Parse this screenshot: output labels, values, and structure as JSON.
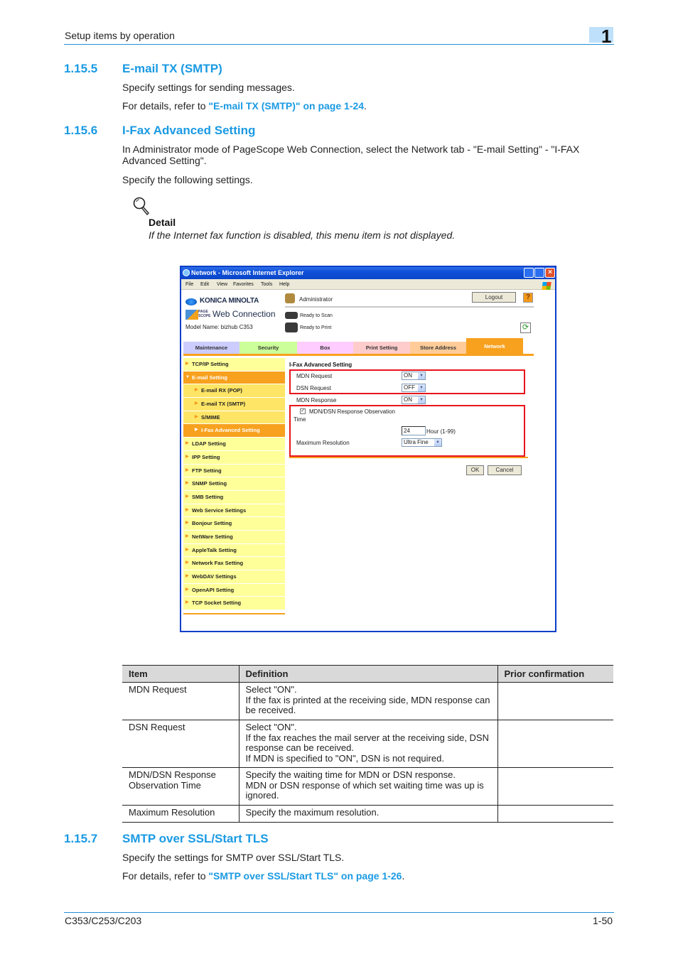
{
  "page_header": {
    "section": "Setup items by operation",
    "chapter": "1"
  },
  "sections": [
    {
      "number": "1.15.5",
      "title": "E-mail TX (SMTP)",
      "paragraphs": [
        "Specify settings for sending messages."
      ],
      "ref_prefix": "For details, refer to ",
      "ref_link": "\"E-mail TX (SMTP)\" on page 1-24",
      "ref_suffix": "."
    },
    {
      "number": "1.15.6",
      "title": "I-Fax Advanced Setting",
      "paragraphs": [
        "In Administrator mode of PageScope Web Connection, select the Network tab - \"E-mail Setting\" - \"I-FAX Advanced Setting\".",
        "Specify the following settings."
      ],
      "detail": {
        "icon": "magnifier-icon",
        "title": "Detail",
        "text": "If the Internet fax function is disabled, this menu item is not displayed."
      }
    },
    {
      "number": "1.15.7",
      "title": "SMTP over SSL/Start TLS",
      "paragraphs": [
        "Specify the settings for SMTP over SSL/Start TLS."
      ],
      "ref_prefix": "For details, refer to ",
      "ref_link": "\"SMTP over SSL/Start TLS\" on page 1-26",
      "ref_suffix": "."
    }
  ],
  "screenshot": {
    "window_title": "Network - Microsoft Internet Explorer",
    "menu": [
      "File",
      "Edit",
      "View",
      "Favorites",
      "Tools",
      "Help"
    ],
    "brand": "KONICA MINOLTA",
    "product_small": "PAGE SCOPE",
    "product": "Web Connection",
    "model": "Model Name: bizhub C353",
    "user": "Administrator",
    "logout": "Logout",
    "help": "?",
    "status_scan": "Ready to Scan",
    "status_print": "Ready to Print",
    "tabs": [
      {
        "label": "Maintenance",
        "color": "#ccccff"
      },
      {
        "label": "Security",
        "color": "#ccff99"
      },
      {
        "label": "Box",
        "color": "#ffccff"
      },
      {
        "label": "Print Setting",
        "color": "#ffcccc"
      },
      {
        "label": "Store Address",
        "color": "#ffcc99"
      },
      {
        "label": "Network",
        "color": "#f7a11e",
        "active": true
      }
    ],
    "sidebar": [
      {
        "label": "TCP/IP Setting"
      },
      {
        "label": "E-mail Setting",
        "active": true,
        "expanded": true
      },
      {
        "label": "E-mail RX (POP)",
        "sub": true
      },
      {
        "label": "E-mail TX (SMTP)",
        "sub": true
      },
      {
        "label": "S/MIME",
        "sub": true
      },
      {
        "label": "I-Fax Advanced Setting",
        "sub": true,
        "active": true
      },
      {
        "label": "LDAP Setting"
      },
      {
        "label": "IPP Setting"
      },
      {
        "label": "FTP Setting"
      },
      {
        "label": "SNMP Setting"
      },
      {
        "label": "SMB Setting"
      },
      {
        "label": "Web Service Settings"
      },
      {
        "label": "Bonjour Setting"
      },
      {
        "label": "NetWare Setting"
      },
      {
        "label": "AppleTalk Setting"
      },
      {
        "label": "Network Fax Setting"
      },
      {
        "label": "WebDAV Settings"
      },
      {
        "label": "OpenAPI Setting"
      },
      {
        "label": "TCP Socket Setting"
      }
    ],
    "form": {
      "title": "I-Fax Advanced Setting",
      "mdn_request_label": "MDN Request",
      "mdn_request_value": "ON",
      "dsn_request_label": "DSN Request",
      "dsn_request_value": "OFF",
      "mdn_response_label": "MDN Response",
      "mdn_response_value": "ON",
      "observation_label": "MDN/DSN Response Observation",
      "observation_label2": "Time",
      "observation_checked": true,
      "time_value": "24",
      "time_unit": "Hour (1-99)",
      "max_res_label": "Maximum Resolution",
      "max_res_value": "Ultra Fine",
      "ok": "OK",
      "cancel": "Cancel"
    }
  },
  "table": {
    "headers": [
      "Item",
      "Definition",
      "Prior confirmation"
    ],
    "rows": [
      {
        "item": "MDN Request",
        "definition": [
          "Select \"ON\".",
          "If the fax is printed at the receiving side, MDN response can be received."
        ],
        "prior": ""
      },
      {
        "item": "DSN Request",
        "definition": [
          "Select \"ON\".",
          "If the fax reaches the mail server at the receiving side, DSN response can be received.",
          "If MDN is specified to \"ON\", DSN is not required."
        ],
        "prior": ""
      },
      {
        "item": "MDN/DSN Response Observation Time",
        "definition": [
          "Specify the waiting time for MDN or DSN response.",
          "MDN or DSN response of which set waiting time was up is ignored."
        ],
        "prior": ""
      },
      {
        "item": "Maximum Resolution",
        "definition": [
          "Specify the maximum resolution."
        ],
        "prior": ""
      }
    ]
  },
  "footer": {
    "model": "C353/C253/C203",
    "page": "1-50"
  }
}
